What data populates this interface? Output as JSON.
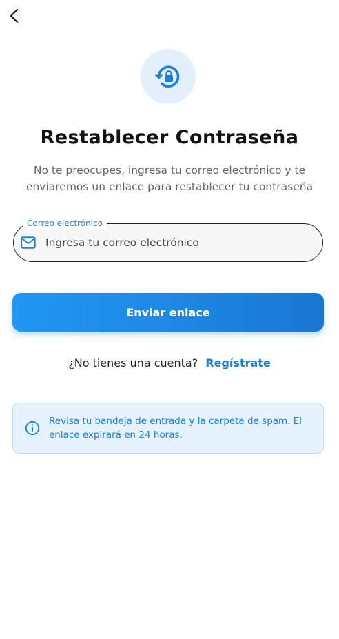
{
  "header": {
    "back_icon": "chevron-left-icon"
  },
  "hero": {
    "icon": "lock-reset-icon",
    "icon_color": "#1f7fd6",
    "icon_bg": "#e3f0fc"
  },
  "title": "Restablecer Contraseña",
  "subtitle": "No te preocupes, ingresa tu correo electrónico y te enviaremos un enlace para restablecer tu contraseña",
  "email_field": {
    "label": "Correo electrónico",
    "placeholder": "Ingresa tu correo electrónico",
    "value": "",
    "icon": "mail-icon"
  },
  "send_button": {
    "label": "Enviar enlace"
  },
  "register": {
    "prompt": "¿No tienes una cuenta?",
    "link": "Regístrate"
  },
  "info": {
    "icon": "info-icon",
    "text": "Revisa tu bandeja de entrada y la carpeta de spam. El enlace expirará en 24 horas."
  },
  "colors": {
    "accent": "#1f7fd6",
    "button_gradient_start": "#2196f3",
    "button_gradient_end": "#1976d2",
    "info_bg": "#e6f2fc",
    "info_border": "#bcdcf6"
  }
}
